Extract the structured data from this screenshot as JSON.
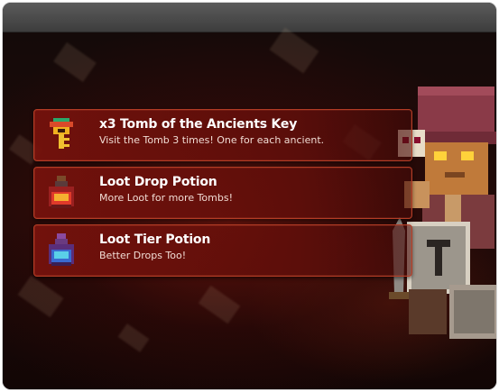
{
  "rewards": [
    {
      "title": "x3 Tomb of the Ancients Key",
      "description": "Visit the Tomb 3 times! One for each ancient.",
      "icon": "key-icon"
    },
    {
      "title": "Loot Drop Potion",
      "description": "More Loot for more Tombs!",
      "icon": "red-potion-icon"
    },
    {
      "title": "Loot Tier Potion",
      "description": "Better Drops Too!",
      "icon": "blue-potion-icon"
    }
  ],
  "colors": {
    "card_border": "#b43c25",
    "card_bg": "#780f0c",
    "title_text": "#ffffff",
    "desc_text": "#f1dcd4"
  }
}
